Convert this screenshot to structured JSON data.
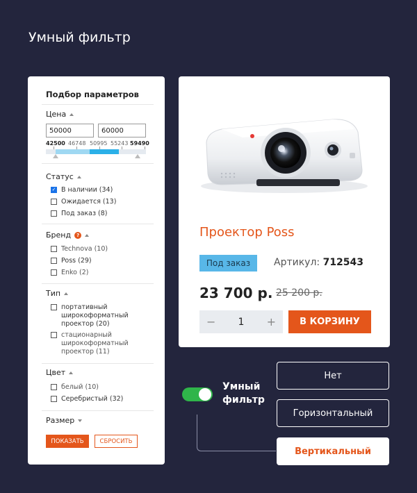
{
  "page": {
    "title": "Умный фильтр"
  },
  "filter": {
    "title": "Подбор параметров",
    "price": {
      "label": "Цена",
      "min_value": "50000",
      "max_value": "60000",
      "scale": [
        "42500",
        "46748",
        "50995",
        "55243",
        "59490"
      ]
    },
    "status": {
      "label": "Статус",
      "options": [
        {
          "label": "В наличии (34)",
          "checked": true
        },
        {
          "label": "Ожидается (13)",
          "checked": false
        },
        {
          "label": "Под заказ (8)",
          "checked": false
        }
      ]
    },
    "brand": {
      "label": "Бренд",
      "help": "?",
      "options": [
        {
          "label": "Technova (10)"
        },
        {
          "label": "Poss (29)"
        },
        {
          "label": "Enko (2)"
        }
      ]
    },
    "type": {
      "label": "Тип",
      "options": [
        {
          "lines": [
            "портативный",
            "широкоформатный",
            "проектор (20)"
          ]
        },
        {
          "lines": [
            "стационарный",
            "широкоформатный",
            "проектор (11)"
          ]
        }
      ]
    },
    "color": {
      "label": "Цвет",
      "options": [
        {
          "label": "белый (10)"
        },
        {
          "label": "Серебристый (32)"
        }
      ]
    },
    "size": {
      "label": "Размер"
    },
    "show_button": "ПОКАЗАТЬ",
    "reset_button": "СБРОСИТЬ"
  },
  "product": {
    "title": "Проектор Poss",
    "badge": "Под заказ",
    "sku_label": "Артикул:",
    "sku_value": "712543",
    "price": "23 700 р.",
    "old_price": "25 200 р.",
    "quantity": "1",
    "minus": "−",
    "plus": "+",
    "cart_button": "В КОРЗИНУ"
  },
  "smart_filter": {
    "toggle_on": true,
    "label_line1": "Умный",
    "label_line2": "фильтр",
    "options": [
      "Нет",
      "Горизонтальный",
      "Вертикальный"
    ],
    "selected": "Вертикальный"
  },
  "colors": {
    "accent": "#e4561b",
    "background": "#23253d",
    "badge": "#58b7e8",
    "toggle": "#2fb54a",
    "slider": "#2bb0e8"
  }
}
